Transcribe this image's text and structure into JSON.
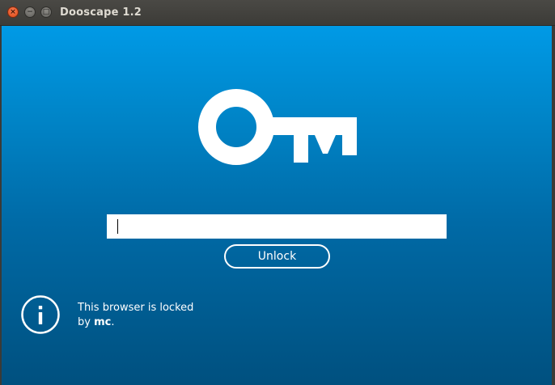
{
  "window": {
    "title": "Dooscape 1.2",
    "controls": {
      "close_glyph": "×",
      "minimize_glyph": "−",
      "maximize_glyph": "□"
    }
  },
  "main": {
    "logo_icon": "key-icon",
    "password": {
      "value": "",
      "placeholder": ""
    },
    "unlock_label": "Unlock"
  },
  "footer": {
    "info_icon": "info-icon",
    "message_prefix": "This browser is locked",
    "message_by": "by ",
    "locked_by_user": "mc",
    "message_suffix": "."
  },
  "colors": {
    "background_top": "#009ae6",
    "background_bottom": "#00507f",
    "foreground": "#ffffff",
    "titlebar": "#3c3b37"
  }
}
